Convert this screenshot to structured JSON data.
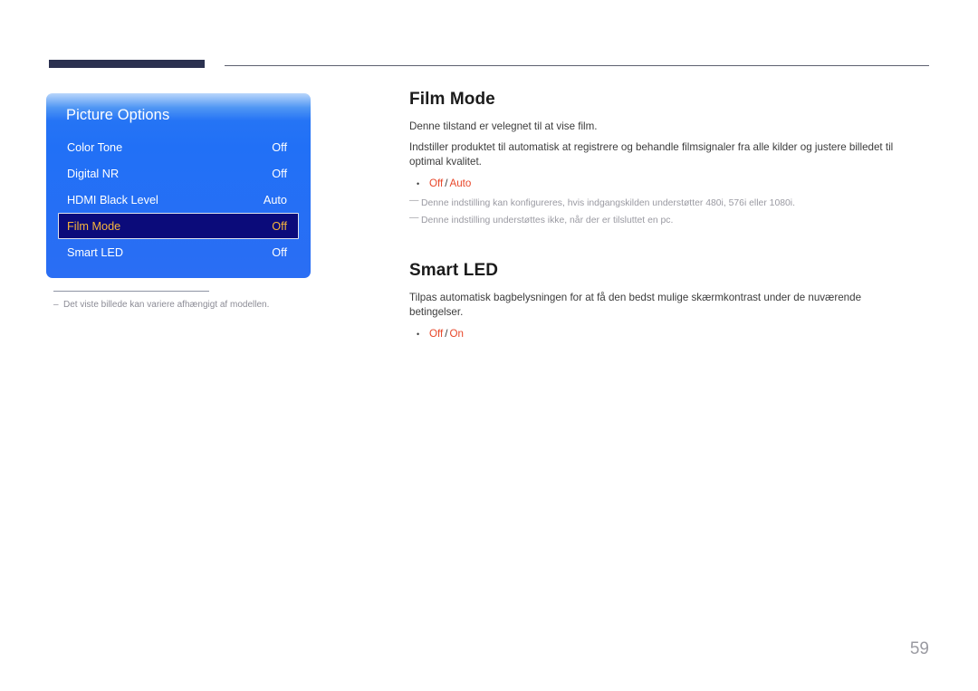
{
  "header": {
    "accent_color": "#2b3150",
    "rule_color": "#5d6170"
  },
  "osd": {
    "title": "Picture Options",
    "rows": [
      {
        "label": "Color Tone",
        "value": "Off",
        "selected": false
      },
      {
        "label": "Digital NR",
        "value": "Off",
        "selected": false
      },
      {
        "label": "HDMI Black Level",
        "value": "Auto",
        "selected": false
      },
      {
        "label": "Film Mode",
        "value": "Off",
        "selected": true
      },
      {
        "label": "Smart LED",
        "value": "Off",
        "selected": false
      }
    ],
    "note_dash": "–",
    "note": "Det viste billede kan variere afhængigt af modellen.",
    "highlight_bg": "#0b0b7a",
    "highlight_text": "#f6b43c",
    "panel_blue": "#2170f6"
  },
  "sections": [
    {
      "title": "Film Mode",
      "paragraphs": [
        "Denne tilstand er velegnet til at vise film.",
        "Indstiller produktet til automatisk at registrere og behandle filmsignaler fra alle kilder og justere billedet til optimal kvalitet."
      ],
      "bullet": {
        "dot": "•",
        "first": "Off",
        "sep": "/",
        "second": "Auto",
        "color": "#e8472a"
      },
      "subnotes": [
        "Denne indstilling kan konfigureres, hvis indgangskilden understøtter 480i, 576i eller 1080i.",
        "Denne indstilling understøttes ikke, når der er tilsluttet en pc."
      ],
      "subnote_dash": "—"
    },
    {
      "title": "Smart LED",
      "paragraphs": [
        "Tilpas automatisk bagbelysningen for at få den bedst mulige skærmkontrast under de nuværende betingelser."
      ],
      "bullet": {
        "dot": "•",
        "first": "Off",
        "sep": "/",
        "second": "On",
        "color": "#e8472a"
      },
      "subnotes": [],
      "subnote_dash": "—"
    }
  ],
  "page_number": "59"
}
